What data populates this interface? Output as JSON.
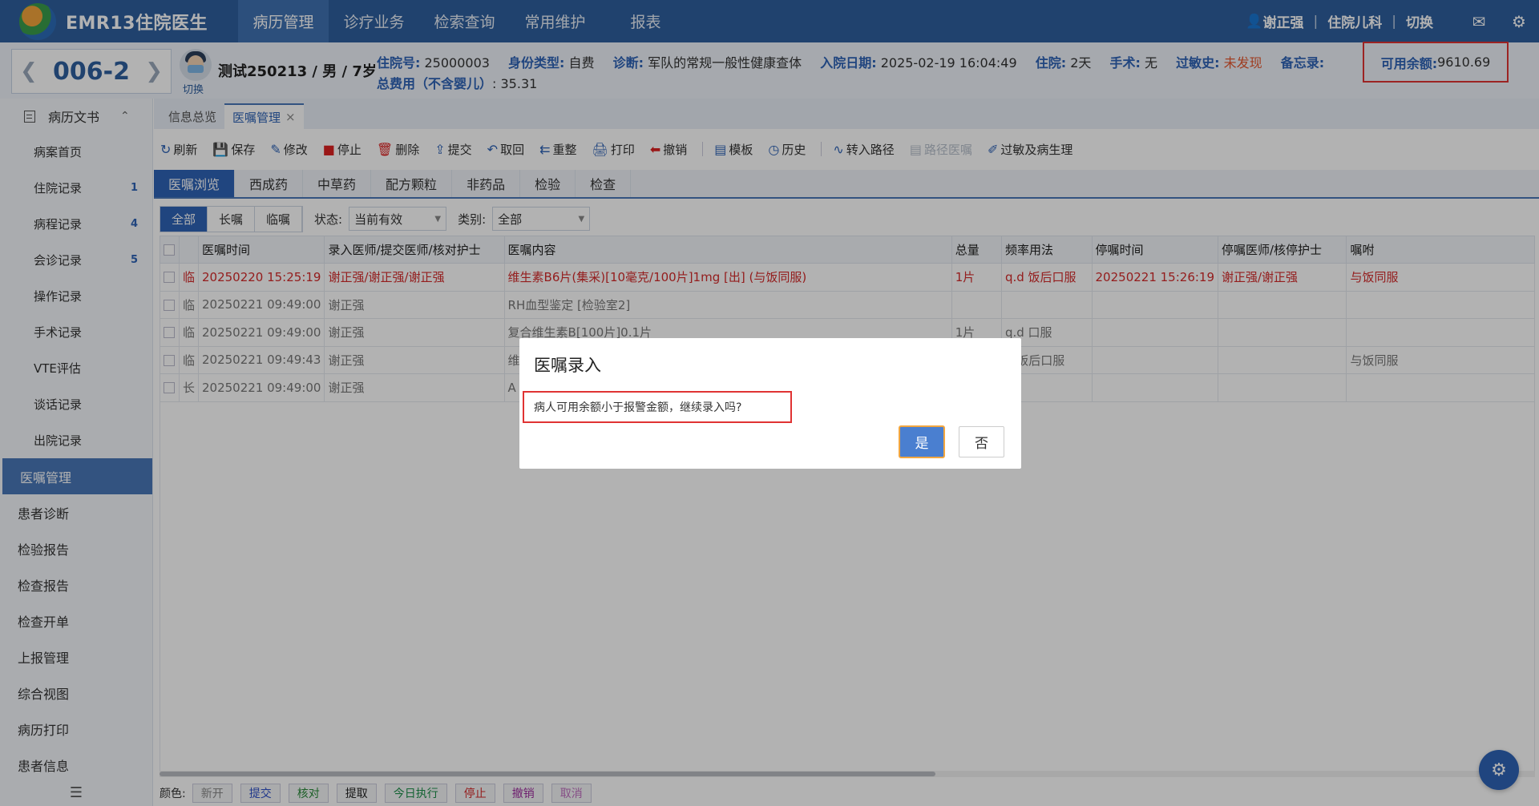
{
  "app": {
    "title": "EMR13住院医生"
  },
  "top_nav": [
    "病历管理",
    "诊疗业务",
    "检索查询",
    "常用维护",
    "报表"
  ],
  "user": {
    "name": "谢正强",
    "dept": "住院儿科",
    "switch": "切换"
  },
  "patient": {
    "bed": "006-2",
    "switch_label": "切换",
    "name_line": "测试250213 / 男 / 7岁",
    "fields": [
      {
        "k": "住院号:",
        "v": " 25000003"
      },
      {
        "k": "身份类型:",
        "v": " 自费"
      },
      {
        "k": "诊断:",
        "v": " 军队的常规一般性健康查体"
      },
      {
        "k": "入院日期:",
        "v": " 2025-02-19 16:04:49"
      },
      {
        "k": "住院:",
        "v": " 2天"
      },
      {
        "k": "手术:",
        "v": " 无"
      },
      {
        "k": "过敏史:",
        "v": " 未发现"
      },
      {
        "k": "备忘录:",
        "v": ""
      }
    ],
    "total_fee_label": "总费用（不含婴儿）",
    "total_fee_value": ": 35.31",
    "balance_label": "可用余额:",
    "balance_value": " 9610.69"
  },
  "sidebar": {
    "group": "病历文书",
    "sub_items": [
      {
        "label": "病案首页",
        "badge": ""
      },
      {
        "label": "住院记录",
        "badge": "1"
      },
      {
        "label": "病程记录",
        "badge": "4"
      },
      {
        "label": "会诊记录",
        "badge": "5"
      },
      {
        "label": "操作记录",
        "badge": ""
      },
      {
        "label": "手术记录",
        "badge": ""
      },
      {
        "label": "VTE评估",
        "badge": ""
      },
      {
        "label": "谈话记录",
        "badge": ""
      },
      {
        "label": "出院记录",
        "badge": ""
      }
    ],
    "items": [
      "医嘱管理",
      "患者诊断",
      "检验报告",
      "检查报告",
      "检查开单",
      "上报管理",
      "综合视图",
      "病历打印",
      "患者信息"
    ]
  },
  "tabs": [
    "信息总览",
    "医嘱管理"
  ],
  "toolbar": [
    "刷新",
    "保存",
    "修改",
    "停止",
    "删除",
    "提交",
    "取回",
    "重整",
    "打印",
    "撤销",
    "模板",
    "历史",
    "转入路径",
    "路径医嘱",
    "过敏及病生理"
  ],
  "order_tabs": [
    "医嘱浏览",
    "西成药",
    "中草药",
    "配方颗粒",
    "非药品",
    "检验",
    "检查"
  ],
  "filter": {
    "segments": [
      "全部",
      "长嘱",
      "临嘱"
    ],
    "status_label": "状态:",
    "status_value": "当前有效",
    "category_label": "类别:",
    "category_value": "全部"
  },
  "grid": {
    "headers": [
      "医嘱时间",
      "录入医师/提交医师/核对护士",
      "医嘱内容",
      "总量",
      "频率用法",
      "停嘱时间",
      "停嘱医师/核停护士",
      "嘱咐"
    ],
    "rows": [
      {
        "type": "临",
        "time": "20250220 15:25:19",
        "doctor": "谢正强/谢正强/谢正强",
        "content": "维生素B6片(集采)[10毫克/100片]1mg [出]   (与饭同服)",
        "qty": "1片",
        "freq": "q.d 饭后口服",
        "stop_time": "20250221 15:26:19",
        "stop_doc": "谢正强/谢正强",
        "note": "与饭同服"
      },
      {
        "type": "临",
        "time": "20250221 09:49:00",
        "doctor": "谢正强",
        "content": "RH血型鉴定 [检验室2]",
        "qty": "",
        "freq": "",
        "stop_time": "",
        "stop_doc": "",
        "note": ""
      },
      {
        "type": "临",
        "time": "20250221 09:49:00",
        "doctor": "谢正强",
        "content": "复合维生素B[100片]0.1片",
        "qty": "1片",
        "freq": "q.d 口服",
        "stop_time": "",
        "stop_doc": "",
        "note": ""
      },
      {
        "type": "临",
        "time": "20250221 09:49:43",
        "doctor": "谢正强",
        "content": "维",
        "qty": "",
        "freq": "d 饭后口服",
        "stop_time": "",
        "stop_doc": "",
        "note": "与饭同服"
      },
      {
        "type": "长",
        "time": "20250221 09:49:00",
        "doctor": "谢正强",
        "content": "A",
        "qty": "",
        "freq": "",
        "stop_time": "",
        "stop_doc": "",
        "note": ""
      }
    ]
  },
  "legend": {
    "label": "颜色:",
    "chips": [
      {
        "text": "新开",
        "color": "#888888"
      },
      {
        "text": "提交",
        "color": "#2f50c8"
      },
      {
        "text": "核对",
        "color": "#2a8a3a"
      },
      {
        "text": "提取",
        "color": "#222222"
      },
      {
        "text": "今日执行",
        "color": "#1e8f4a"
      },
      {
        "text": "停止",
        "color": "#d42a2a"
      },
      {
        "text": "撤销",
        "color": "#a030a0"
      },
      {
        "text": "取消",
        "color": "#c070c0"
      }
    ]
  },
  "modal": {
    "title": "医嘱录入",
    "message": "病人可用余额小于报警金额，继续录入吗?",
    "yes": "是",
    "no": "否"
  }
}
